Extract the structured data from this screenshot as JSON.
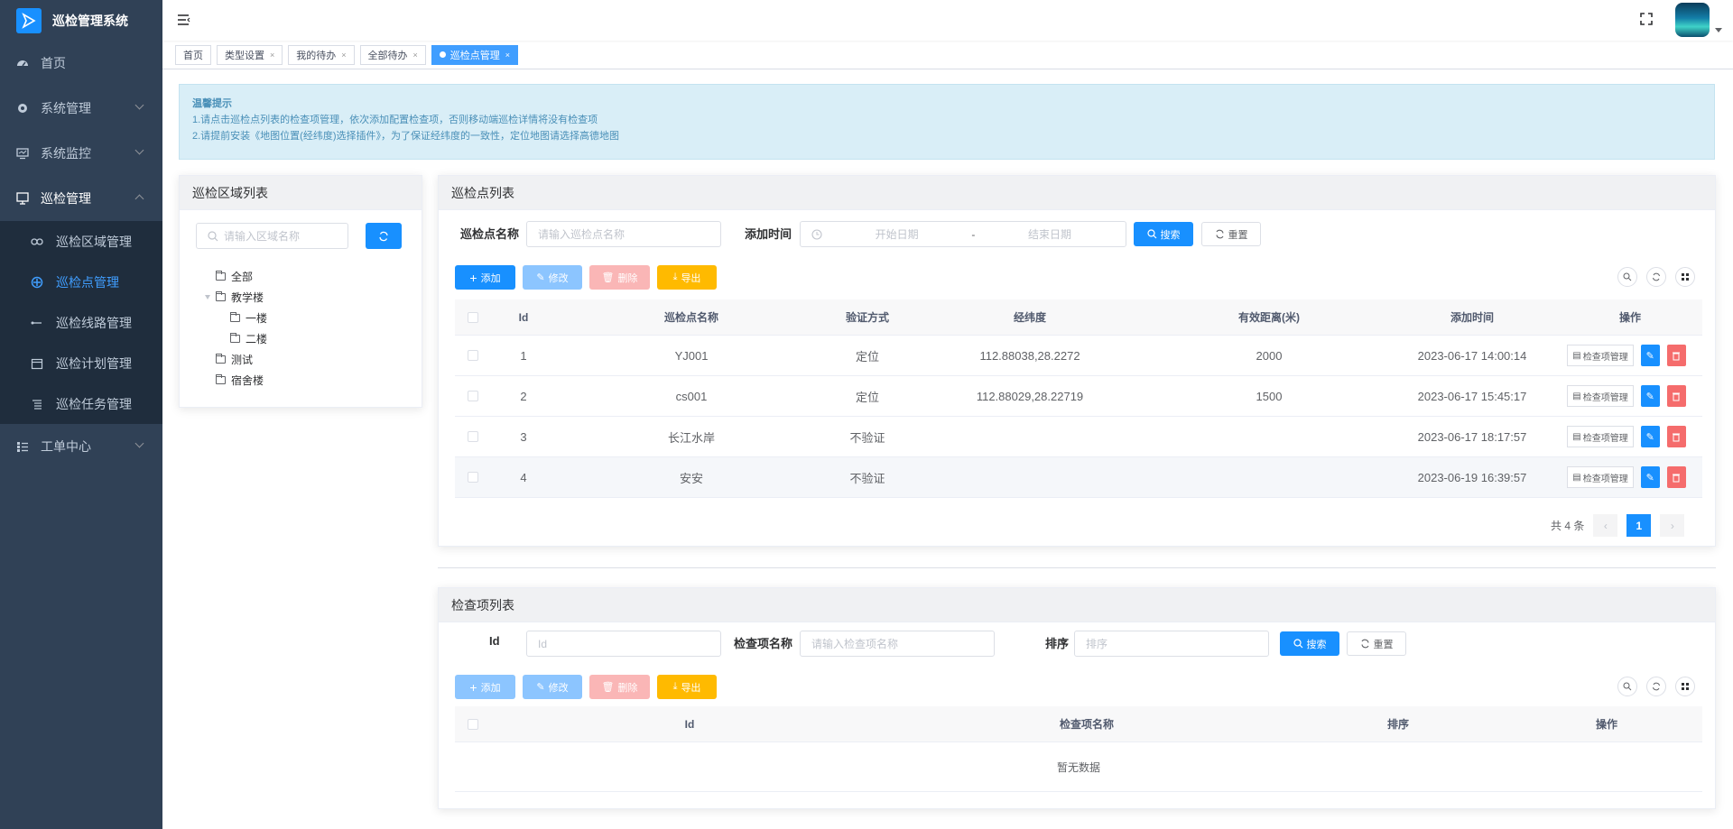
{
  "app": {
    "title": "巡检管理系统"
  },
  "sidebar": {
    "items": [
      {
        "label": "首页",
        "icon": "dashboard-icon"
      },
      {
        "label": "系统管理",
        "icon": "gear-icon"
      },
      {
        "label": "系统监控",
        "icon": "monitor-icon"
      },
      {
        "label": "巡检管理",
        "icon": "inspection-icon"
      },
      {
        "label": "工单中心",
        "icon": "list-icon"
      }
    ],
    "sub_items": [
      {
        "label": "巡检区域管理",
        "icon": "link-icon"
      },
      {
        "label": "巡检点管理",
        "icon": "point-icon"
      },
      {
        "label": "巡检线路管理",
        "icon": "route-icon"
      },
      {
        "label": "巡检计划管理",
        "icon": "calendar-icon"
      },
      {
        "label": "巡检任务管理",
        "icon": "task-icon"
      }
    ]
  },
  "tags": [
    "首页",
    "类型设置",
    "我的待办",
    "全部待办",
    "巡检点管理"
  ],
  "tip": {
    "title": "温馨提示",
    "line1": "1.请点击巡检点列表的检查项管理，依次添加配置检查项，否则移动端巡检详情将没有检查项",
    "line2": "2.请提前安装《地图位置(经纬度)选择插件》，为了保证经纬度的一致性，定位地图请选择高德地图"
  },
  "area_panel": {
    "title": "巡检区域列表",
    "search_placeholder": "请输入区域名称",
    "tree": [
      "全部",
      "教学楼",
      "一楼",
      "二楼",
      "测试",
      "宿舍楼"
    ]
  },
  "point_panel": {
    "title": "巡检点列表",
    "name_label": "巡检点名称",
    "name_placeholder": "请输入巡检点名称",
    "time_label": "添加时间",
    "start_placeholder": "开始日期",
    "range_sep": "-",
    "end_placeholder": "结束日期",
    "search_btn": "搜索",
    "reset_btn": "重置",
    "add_btn": "添加",
    "edit_btn": "修改",
    "delete_btn": "删除",
    "export_btn": "导出",
    "columns": [
      "Id",
      "巡检点名称",
      "验证方式",
      "经纬度",
      "有效距离(米)",
      "添加时间",
      "操作"
    ],
    "rows": [
      {
        "id": "1",
        "name": "YJ001",
        "verify": "定位",
        "lnglat": "112.88038,28.2272",
        "distance": "2000",
        "time": "2023-06-17 14:00:14"
      },
      {
        "id": "2",
        "name": "cs001",
        "verify": "定位",
        "lnglat": "112.88029,28.22719",
        "distance": "1500",
        "time": "2023-06-17 15:45:17"
      },
      {
        "id": "3",
        "name": "长江水岸",
        "verify": "不验证",
        "lnglat": "",
        "distance": "",
        "time": "2023-06-17 18:17:57"
      },
      {
        "id": "4",
        "name": "安安",
        "verify": "不验证",
        "lnglat": "",
        "distance": "",
        "time": "2023-06-19 16:39:57"
      }
    ],
    "row_action": "检查项管理",
    "total": "共 4 条",
    "page": "1"
  },
  "check_panel": {
    "title": "检查项列表",
    "id_label": "Id",
    "id_placeholder": "Id",
    "name_label": "检查项名称",
    "name_placeholder": "请输入检查项名称",
    "sort_label": "排序",
    "sort_placeholder": "排序",
    "search_btn": "搜索",
    "reset_btn": "重置",
    "add_btn": "添加",
    "edit_btn": "修改",
    "delete_btn": "删除",
    "export_btn": "导出",
    "columns": [
      "Id",
      "检查项名称",
      "排序",
      "操作"
    ],
    "empty": "暂无数据"
  },
  "colors": {
    "sidebar_bg": "#304156",
    "primary": "#1890ff",
    "danger": "#f56c6c",
    "warning": "#ffba00"
  }
}
